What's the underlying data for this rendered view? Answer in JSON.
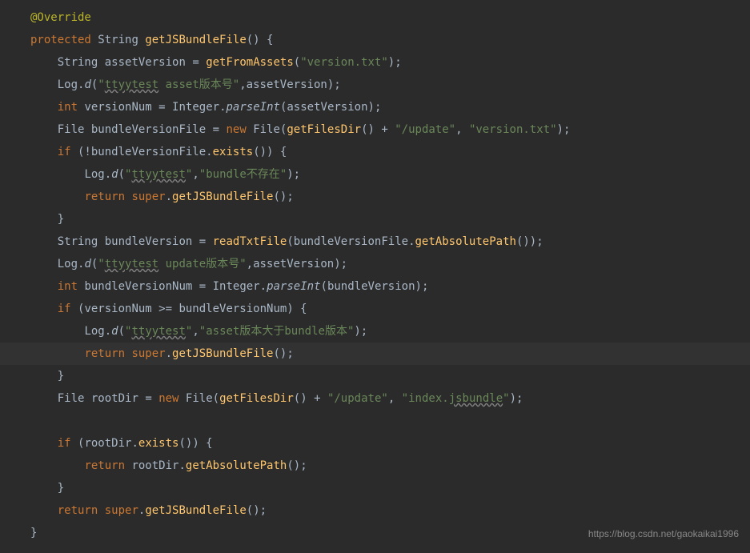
{
  "code": {
    "override": "@Override",
    "protected": "protected",
    "string_type": "String",
    "method_name": "getJSBundleFile",
    "getFromAssets": "getFromAssets",
    "version_txt": "\"version.txt\"",
    "assetVersion_var": "assetVersion",
    "log_d": "Log",
    "d_method": "d",
    "ttyytest_asset": "\"ttyytest asset版本号\"",
    "int_kw": "int",
    "versionNum_var": "versionNum",
    "integer_cls": "Integer",
    "parseInt": "parseInt",
    "file_type": "File",
    "bundleVersionFile_var": "bundleVersionFile",
    "new_kw": "new",
    "getFilesDir": "getFilesDir",
    "update_path": "\"/update\"",
    "if_kw": "if",
    "exists": "exists",
    "ttyytest_only": "\"ttyytest\"",
    "bundle_not_exist": "\"bundle不存在\"",
    "return_kw": "return",
    "super_kw": "super",
    "bundleVersion_var": "bundleVersion",
    "readTxtFile": "readTxtFile",
    "getAbsolutePath": "getAbsolutePath",
    "ttyytest_update": "\"ttyytest update版本号\"",
    "bundleVersionNum_var": "bundleVersionNum",
    "asset_gt_bundle": "\"asset版本大于bundle版本\"",
    "rootDir_var": "rootDir",
    "index_jsbundle": "\"index.jsbundle\"",
    "index_jsbundle_underline": "jsbundle"
  },
  "watermark": "https://blog.csdn.net/gaokaikai1996"
}
